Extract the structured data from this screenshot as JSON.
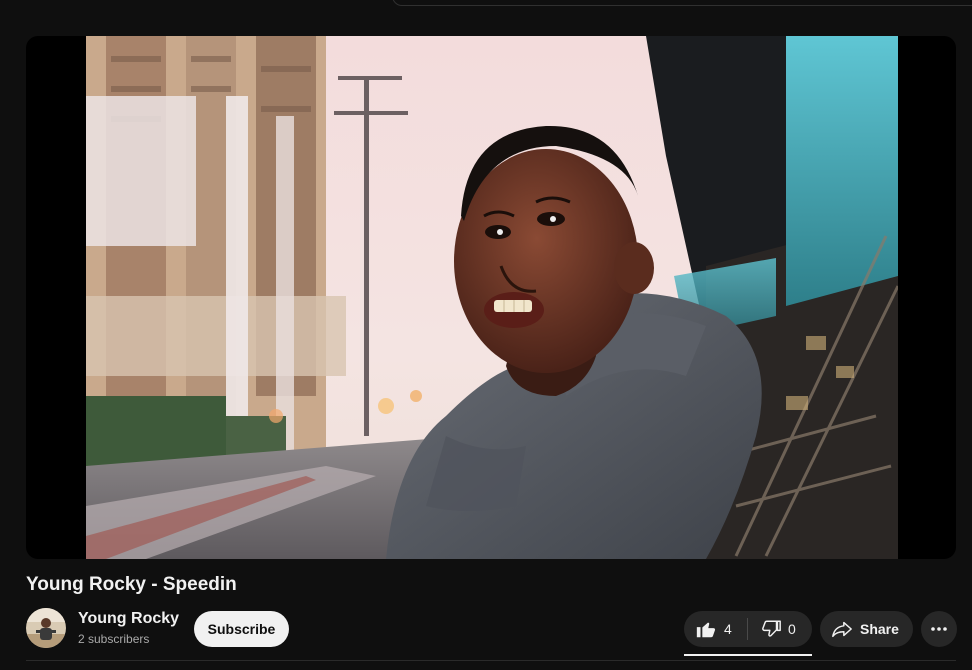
{
  "video": {
    "title": "Young Rocky - Speedin"
  },
  "channel": {
    "name": "Young Rocky",
    "subscribers": "2 subscribers",
    "subscribe_label": "Subscribe"
  },
  "actions": {
    "like_icon": "thumb-up-icon",
    "like_count": "4",
    "dislike_icon": "thumb-down-icon",
    "dislike_count": "0",
    "share_icon": "share-arrow-icon",
    "share_label": "Share",
    "more_icon": "more-horizontal-icon"
  },
  "colors": {
    "background": "#0f0f0f",
    "button_bg": "#272727",
    "subscribe_bg": "#f1f1f1",
    "text_primary": "#f1f1f1",
    "text_secondary": "#aaaaaa"
  }
}
